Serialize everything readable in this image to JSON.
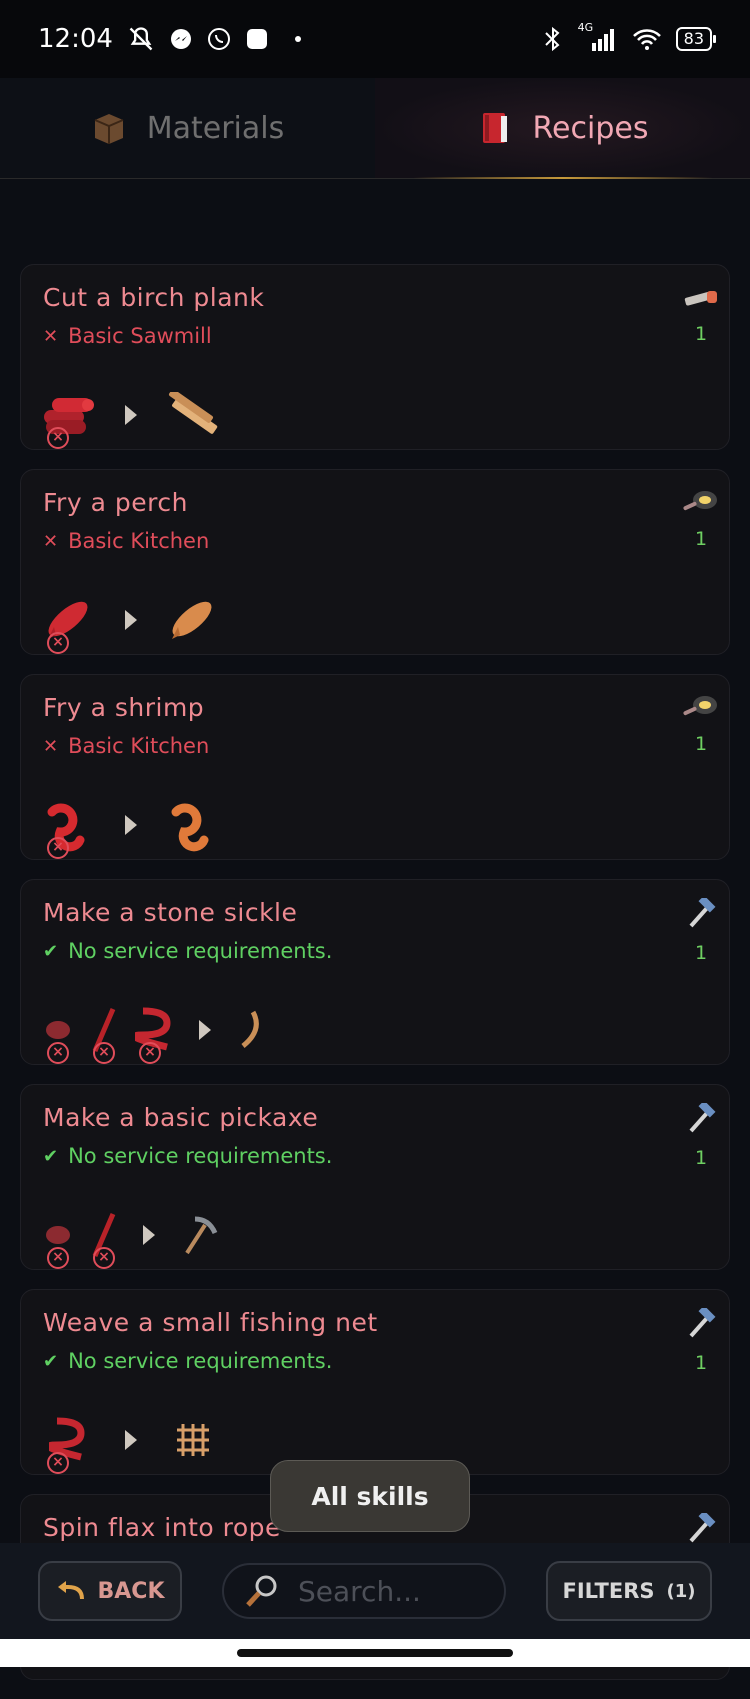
{
  "status_bar": {
    "time": "12:04",
    "battery": "83",
    "network": "4G",
    "icons": [
      "mute-icon",
      "messenger-icon",
      "whatsapp-icon",
      "app-icon",
      "dot-icon",
      "bluetooth-icon",
      "signal-icon",
      "wifi-icon",
      "battery-icon"
    ]
  },
  "tabs": [
    {
      "label": "Materials",
      "icon": "crate-icon",
      "active": false
    },
    {
      "label": "Recipes",
      "icon": "book-icon",
      "active": true
    }
  ],
  "recipes": [
    {
      "title": "Cut a birch plank",
      "requirement": "Basic Sawmill",
      "requirement_met": false,
      "skill_icon": "saw-icon",
      "level": "1",
      "inputs": [
        "birch-log-icon"
      ],
      "outputs": [
        "plank-icon"
      ]
    },
    {
      "title": "Fry a perch",
      "requirement": "Basic Kitchen",
      "requirement_met": false,
      "skill_icon": "pan-icon",
      "level": "1",
      "inputs": [
        "raw-perch-icon"
      ],
      "outputs": [
        "fried-perch-icon"
      ]
    },
    {
      "title": "Fry a shrimp",
      "requirement": "Basic Kitchen",
      "requirement_met": false,
      "skill_icon": "pan-icon",
      "level": "1",
      "inputs": [
        "raw-shrimp-icon"
      ],
      "outputs": [
        "fried-shrimp-icon"
      ]
    },
    {
      "title": "Make a stone sickle",
      "requirement": "No service requirements.",
      "requirement_met": true,
      "skill_icon": "hammer-icon",
      "level": "1",
      "inputs": [
        "stone-icon",
        "stick-icon",
        "rope-icon"
      ],
      "outputs": [
        "sickle-icon"
      ]
    },
    {
      "title": "Make a basic pickaxe",
      "requirement": "No service requirements.",
      "requirement_met": true,
      "skill_icon": "hammer-icon",
      "level": "1",
      "inputs": [
        "stone-icon",
        "stick-icon"
      ],
      "outputs": [
        "pickaxe-icon"
      ]
    },
    {
      "title": "Weave a small fishing net",
      "requirement": "No service requirements.",
      "requirement_met": true,
      "skill_icon": "hammer-icon",
      "level": "1",
      "inputs": [
        "rope-icon"
      ],
      "outputs": [
        "fishing-net-icon"
      ]
    },
    {
      "title": "Spin flax into rope",
      "skill_icon": "hammer-icon"
    }
  ],
  "popup": {
    "label": "All skills"
  },
  "bottom": {
    "back_label": "BACK",
    "search_placeholder": "Search...",
    "filters_label": "FILTERS",
    "filters_count": "(1)"
  },
  "colors": {
    "accent": "#ee8a91",
    "requirement_bad": "#e04d5a",
    "requirement_ok": "#5fd062",
    "level": "#6fcf62"
  }
}
